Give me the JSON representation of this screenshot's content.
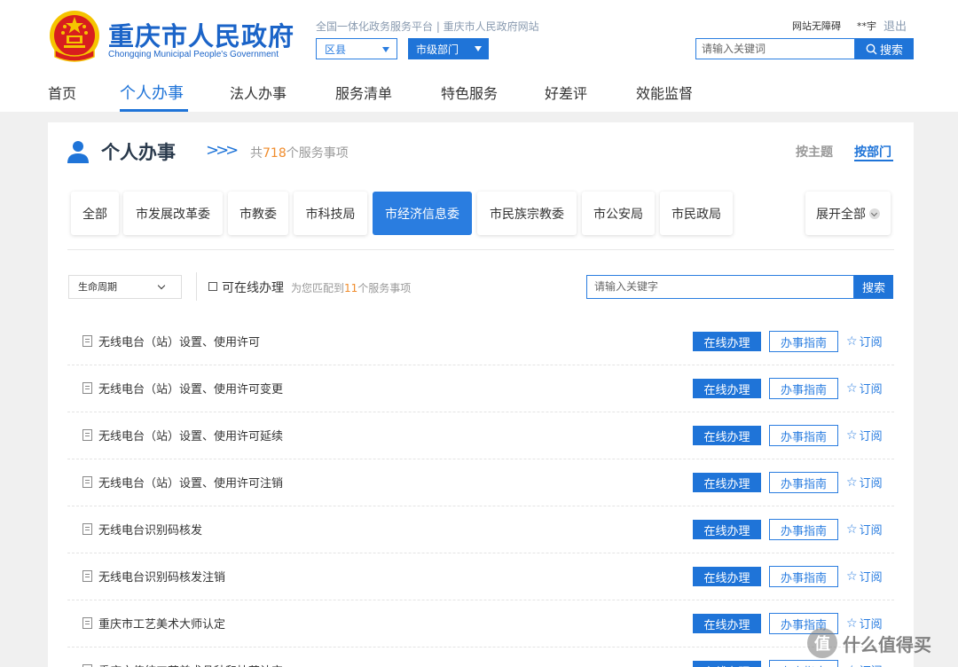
{
  "header": {
    "logo_cn": "重庆市人民政府",
    "logo_en": "Chongqing Municipal People's Government",
    "tagline": "全国一体化政务服务平台 | 重庆市人民政府网站",
    "county_select": "区县",
    "dept_select": "市级部门",
    "accessibility": "网站无障碍",
    "user": "**宇",
    "logout": "退出",
    "search_placeholder": "请输入关键词",
    "search_button": "搜索"
  },
  "nav": {
    "items": [
      "首页",
      "个人办事",
      "法人办事",
      "服务清单",
      "特色服务",
      "好差评",
      "效能监督"
    ],
    "active_index": 1
  },
  "section": {
    "title": "个人办事",
    "count_prefix": "共",
    "count": "718",
    "count_suffix": "个服务事项",
    "view_by_theme": "按主题",
    "view_by_dept": "按部门"
  },
  "tabs": {
    "items": [
      "全部",
      "市发展改革委",
      "市教委",
      "市科技局",
      "市经济信息委",
      "市民族宗教委",
      "市公安局",
      "市民政局"
    ],
    "active_index": 4,
    "expand": "展开全部"
  },
  "filters": {
    "lifecycle": "生命周期",
    "online_only": "可在线办理",
    "match_prefix": "为您匹配到",
    "match_count": "11",
    "match_suffix": "个服务事项",
    "keyword_placeholder": "请输入关键字",
    "search_button": "搜索"
  },
  "services": [
    {
      "name": "无线电台（站）设置、使用许可"
    },
    {
      "name": "无线电台（站）设置、使用许可变更"
    },
    {
      "name": "无线电台（站）设置、使用许可延续"
    },
    {
      "name": "无线电台（站）设置、使用许可注销"
    },
    {
      "name": "无线电台识别码核发"
    },
    {
      "name": "无线电台识别码核发注销"
    },
    {
      "name": "重庆市工艺美术大师认定"
    },
    {
      "name": "重庆市传统工艺美术品种和技艺认定"
    }
  ],
  "row_actions": {
    "online": "在线办理",
    "guide": "办事指南",
    "subscribe": "订阅"
  },
  "watermark": {
    "glyph": "值",
    "text": "什么值得买"
  },
  "colors": {
    "primary": "#1f74d8",
    "accent": "#f08c2c",
    "emblem_red": "#d81e1e",
    "emblem_gold": "#f5c400"
  }
}
